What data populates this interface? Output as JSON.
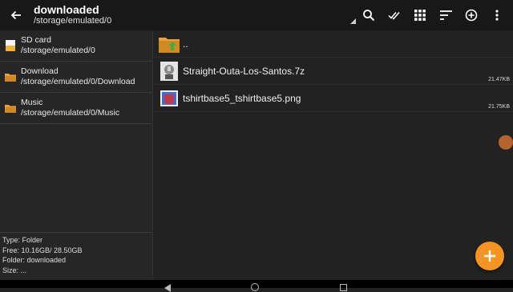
{
  "header": {
    "title": "downloaded",
    "path": "/storage/emulated/0",
    "icons": [
      "back-arrow-icon",
      "search-icon",
      "select-all-icon",
      "grid-view-icon",
      "sort-icon",
      "add-circle-icon",
      "more-vert-icon"
    ]
  },
  "sidebar": {
    "items": [
      {
        "label": "SD card",
        "path": "/storage/emulated/0",
        "icon": "sd-card-icon"
      },
      {
        "label": "Download",
        "path": "/storage/emulated/0/Download",
        "icon": "folder-icon"
      },
      {
        "label": "Music",
        "path": "/storage/emulated/0/Music",
        "icon": "folder-icon"
      }
    ],
    "info": {
      "type": "Type: Folder",
      "free": "Free: 10.16GB/ 28.50GB",
      "folder": "Folder: downloaded",
      "size": "Size: ..."
    }
  },
  "files": [
    {
      "name": "..",
      "size": "",
      "icon": "parent-folder-icon"
    },
    {
      "name": "Straight-Outa-Los-Santos.7z",
      "size": "21.47KB",
      "icon": "archive-icon"
    },
    {
      "name": "tshirtbase5_tshirtbase5.png",
      "size": "21.75KB",
      "icon": "image-icon"
    }
  ],
  "colors": {
    "accent": "#f39423",
    "folder": "#e8a13a",
    "background": "#222222",
    "header": "#181818"
  }
}
